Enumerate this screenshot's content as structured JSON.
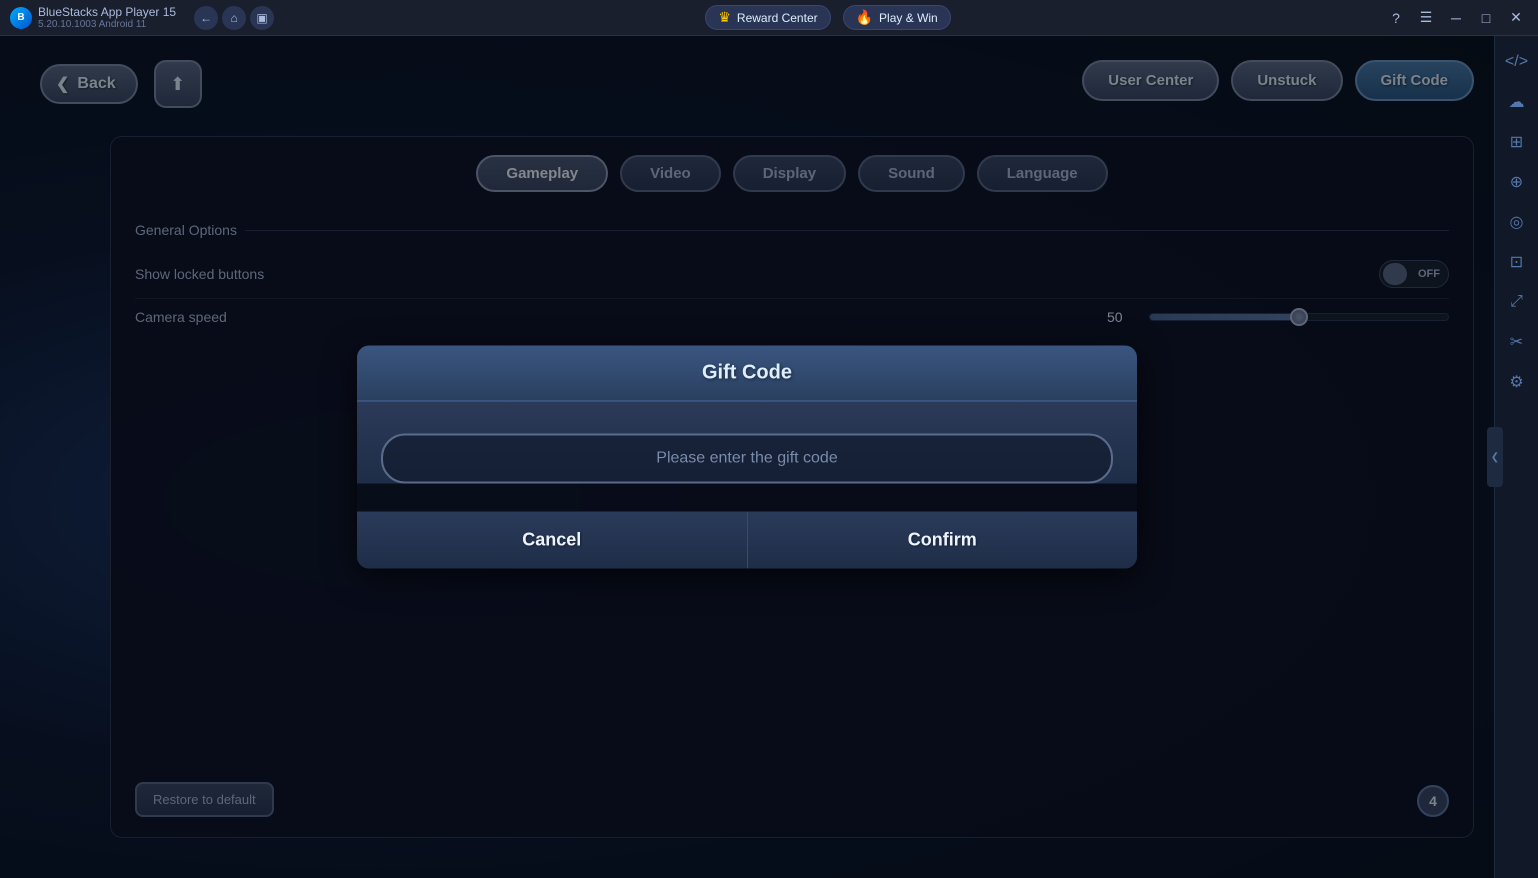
{
  "app": {
    "title": "BlueStacks App Player 15",
    "subtitle": "5.20.10.1003  Android 11"
  },
  "topbar": {
    "reward_center": "Reward Center",
    "play_win": "Play & Win",
    "back_btn": "←",
    "minimize": "─",
    "maximize": "□",
    "close": "×",
    "question": "?"
  },
  "header": {
    "back_label": "Back",
    "user_center": "User Center",
    "unstuck": "Unstuck",
    "gift_code": "Gift Code"
  },
  "tabs": {
    "items": [
      {
        "id": "gameplay",
        "label": "Gameplay",
        "active": true
      },
      {
        "id": "video",
        "label": "Video",
        "active": false
      },
      {
        "id": "display",
        "label": "Display",
        "active": false
      },
      {
        "id": "sound",
        "label": "Sound",
        "active": false
      },
      {
        "id": "language",
        "label": "Language",
        "active": false
      }
    ]
  },
  "settings": {
    "section_title": "General Options",
    "show_locked_label": "Show locked buttons",
    "show_locked_value": "OFF",
    "camera_speed_label": "Camera speed",
    "camera_speed_value": "50",
    "restore_btn": "Restore to default",
    "step_indicator": "4"
  },
  "dialog": {
    "title": "Gift Code",
    "input_placeholder": "Please enter the gift code",
    "cancel_label": "Cancel",
    "confirm_label": "Confirm"
  },
  "sidebar": {
    "icons": [
      "⟨⟩",
      "☁",
      "⊞",
      "⊕",
      "◎",
      "⊡",
      "↕",
      "✂",
      "⚙"
    ]
  }
}
